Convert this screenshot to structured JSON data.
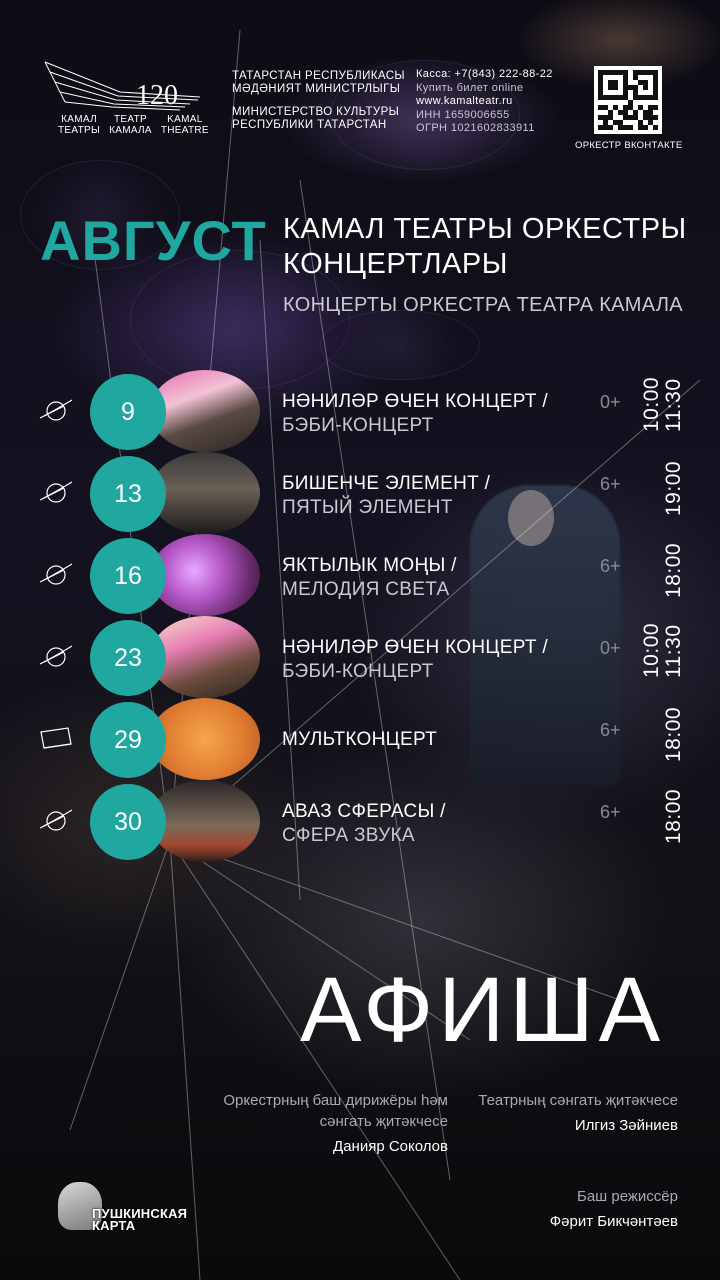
{
  "header": {
    "logo_number": "120",
    "logo_labels": [
      [
        "КАМАЛ",
        "ТЕАТРЫ"
      ],
      [
        "ТЕАТР",
        "КАМАЛА"
      ],
      [
        "KAMAL",
        "THEATRE"
      ]
    ],
    "ministry_tat_1": "ТАТАРСТАН РЕСПУБЛИКАСЫ",
    "ministry_tat_2": "МӘДӘНИЯТ МИНИСТРЛЫГЫ",
    "ministry_ru_1": "МИНИСТЕРСТВО КУЛЬТУРЫ",
    "ministry_ru_2": "РЕСПУБЛИКИ ТАТАРСТАН",
    "box_office": "Касса: +7(843) 222-88-22",
    "buy_online": "Купить билет online",
    "website": "www.kamalteatr.ru",
    "inn": "ИНН 1659006655",
    "ogrn": "ОГРН 1021602833911",
    "qr_label": "ОРКЕСТР ВКОНТАКТЕ"
  },
  "month": "АВГУСТ",
  "title_tat_1": "КАМАЛ ТЕАТРЫ ОРКЕСТРЫ",
  "title_tat_2": "КОНЦЕРТЛАРЫ",
  "title_ru": "КОНЦЕРТЫ ОРКЕСТРА ТЕАТРА КАМАЛА",
  "events": [
    {
      "day": "9",
      "name_tat": "НӘНИЛӘР ӨЧЕН КОНЦЕРТ /",
      "name_ru": "БЭБИ-КОНЦЕРТ",
      "age": "0+",
      "times": [
        "10:00",
        "11:30"
      ],
      "icon": "globe-icon"
    },
    {
      "day": "13",
      "name_tat": "БИШЕНЧЕ ЭЛЕМЕНТ /",
      "name_ru": "ПЯТЫЙ ЭЛЕМЕНТ",
      "age": "6+",
      "times": [
        "19:00"
      ],
      "icon": "globe-icon"
    },
    {
      "day": "16",
      "name_tat": "ЯКТЫЛЫК МОҢЫ /",
      "name_ru": "МЕЛОДИЯ СВЕТА",
      "age": "6+",
      "times": [
        "18:00"
      ],
      "icon": "globe-icon"
    },
    {
      "day": "23",
      "name_tat": "НӘНИЛӘР ӨЧЕН КОНЦЕРТ /",
      "name_ru": "БЭБИ-КОНЦЕРТ",
      "age": "0+",
      "times": [
        "10:00",
        "11:30"
      ],
      "icon": "globe-icon"
    },
    {
      "day": "29",
      "name_tat": "МУЛЬТКОНЦЕРТ",
      "name_ru": "",
      "age": "6+",
      "times": [
        "18:00"
      ],
      "icon": "screen-icon"
    },
    {
      "day": "30",
      "name_tat": "АВАЗ СФЕРАСЫ /",
      "name_ru": "СФЕРА ЗВУКА",
      "age": "6+",
      "times": [
        "18:00"
      ],
      "icon": "globe-icon"
    }
  ],
  "afisha": "АФИША",
  "credits": {
    "conductor_role": "Оркестрның баш дирижёры һәм сәнгать җитәкчесе",
    "conductor_name": "Данияр Соколов",
    "art_director_role": "Театрның сәнгать җитәкчесе",
    "art_director_name": "Илгиз Зәйниев",
    "main_director_role": "Баш режиссёр",
    "main_director_name": "Фәрит Бикчәнтәев"
  },
  "pushkin_card": [
    "ПУШКИНСКАЯ",
    "КАРТА"
  ],
  "colors": {
    "accent": "#1fa7a0",
    "background": "#0b0a10"
  }
}
